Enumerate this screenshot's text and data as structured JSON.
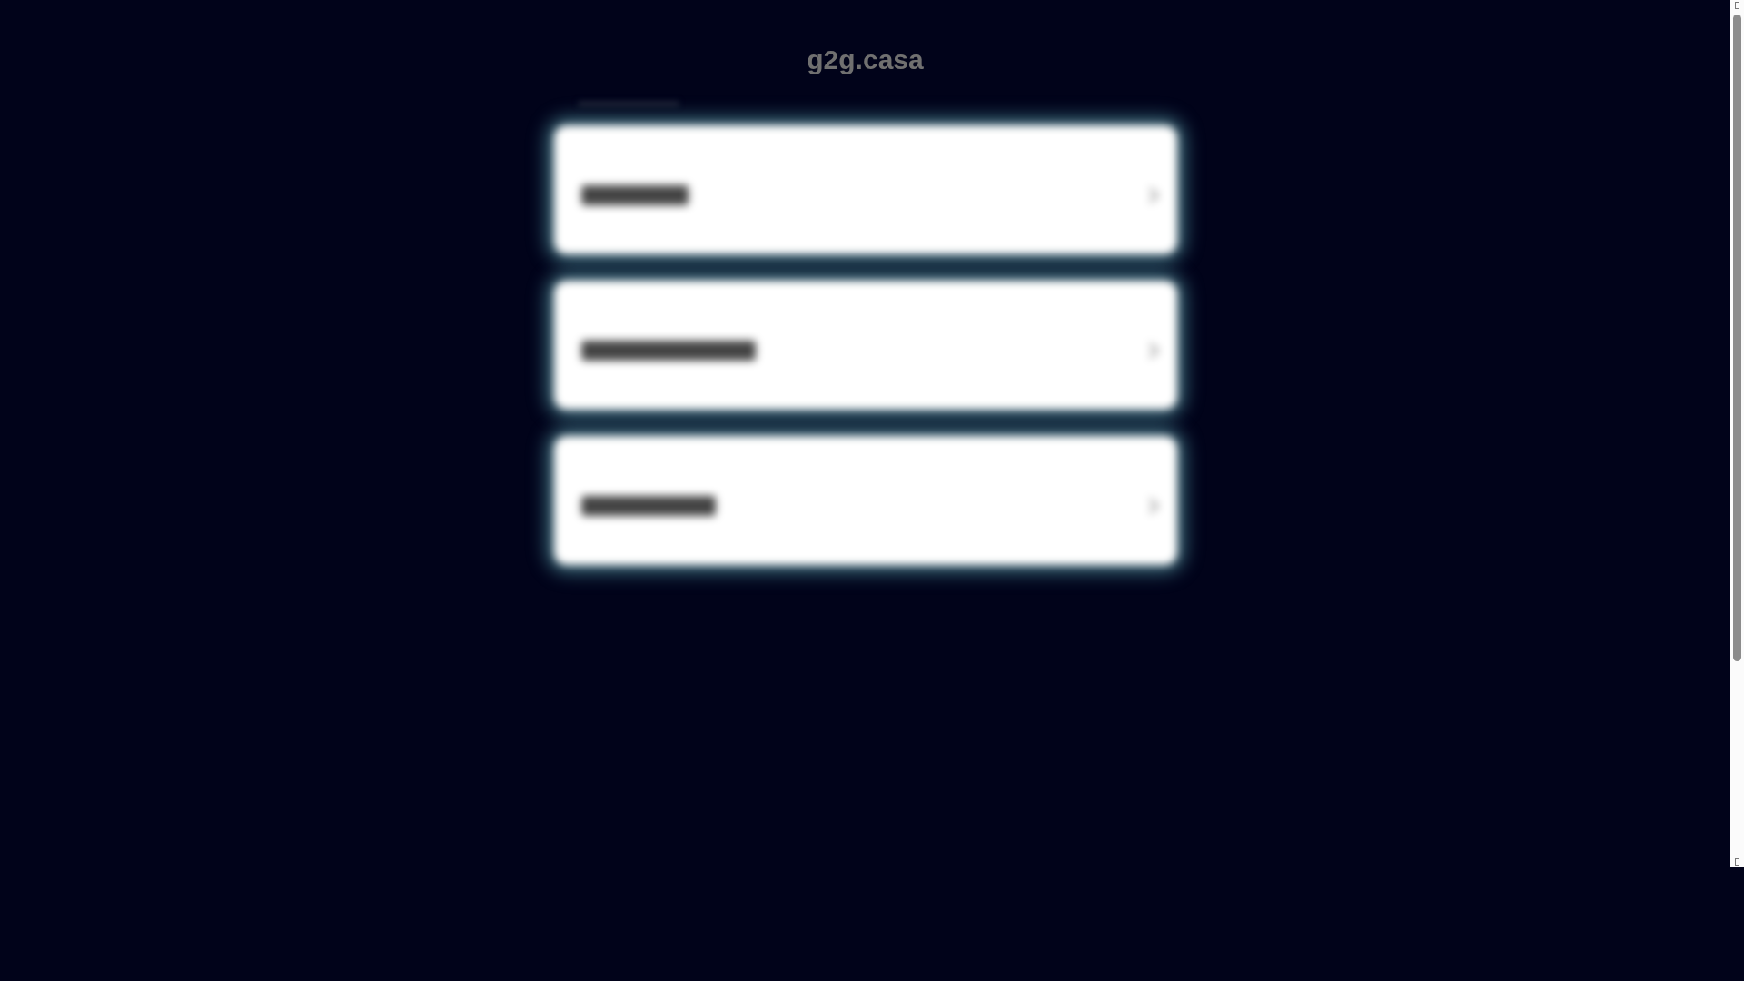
{
  "page": {
    "title": "g2g.casa"
  },
  "related_links": {
    "heading": {
      "kind": "blurred"
    },
    "items": [
      {
        "kind": "blurred_link"
      },
      {
        "kind": "blurred_link"
      },
      {
        "kind": "blurred_link"
      }
    ]
  }
}
